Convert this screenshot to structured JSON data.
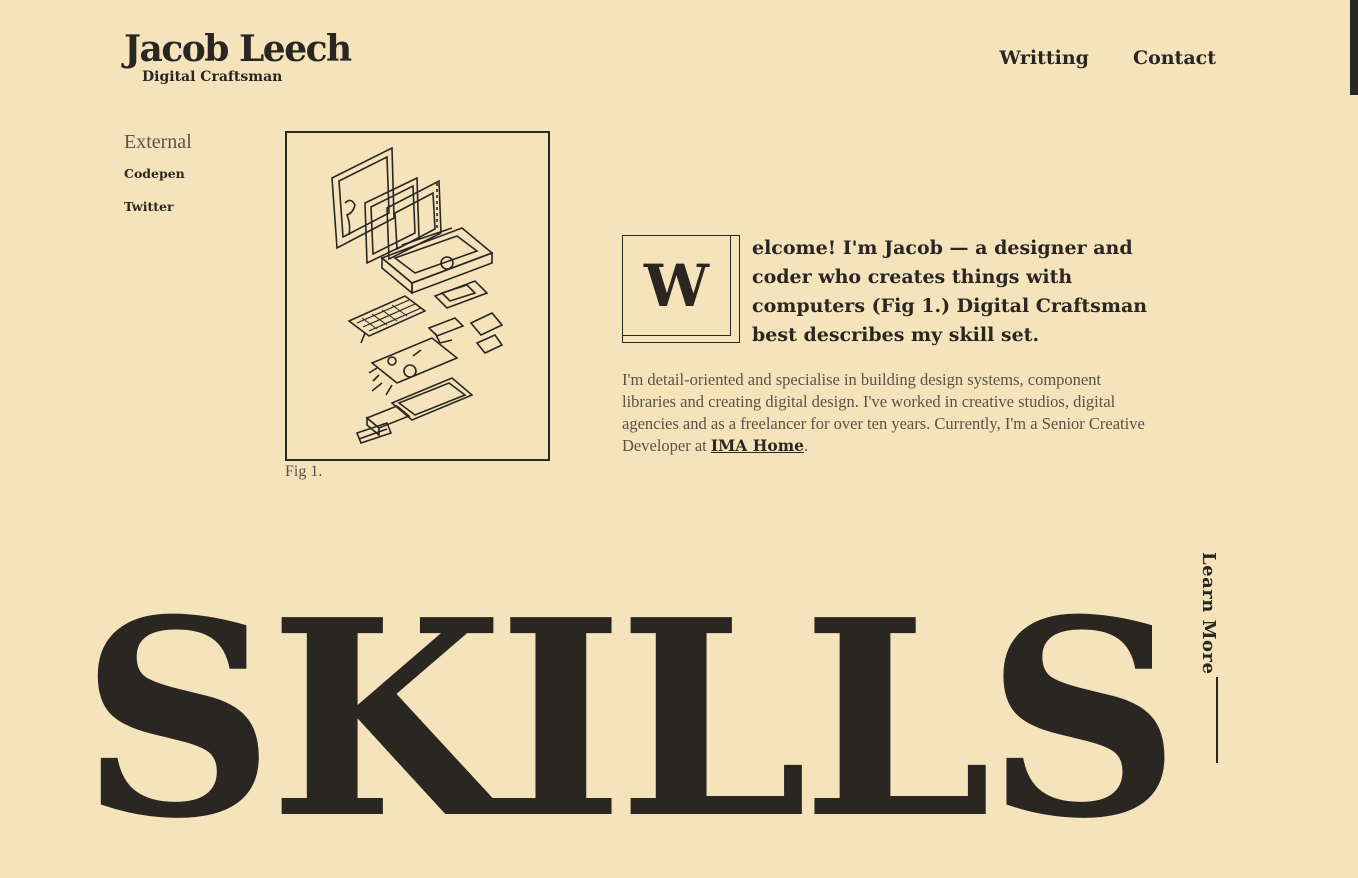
{
  "brand": {
    "name": "Jacob Leech",
    "tagline": "Digital Craftsman"
  },
  "nav": {
    "items": [
      "Writting",
      "Contact"
    ]
  },
  "sidebar": {
    "heading": "External",
    "links": [
      "Codepen",
      "Twitter"
    ]
  },
  "figure": {
    "caption": "Fig 1.",
    "image_icon": "exploded-laptop-illustration"
  },
  "intro": {
    "dropcap": "W",
    "lead": "elcome! I'm Jacob — a designer and coder who creates things with computers (Fig 1.) Digital Craftsman best describes my skill set.",
    "body_text": "I'm detail-oriented and specialise in building design systems, component libraries and creating digital design. I've worked in creative studios, digital agencies and as a freelancer for over ten years. Currently, I'm a Senior Creative Developer at ",
    "company_link": "IMA Home",
    "body_end": "."
  },
  "learn_more": "Learn More",
  "skills_heading": "SKILLS",
  "colors": {
    "background": "#f5e3bc",
    "ink": "#2a2723",
    "muted": "#5a5347"
  }
}
